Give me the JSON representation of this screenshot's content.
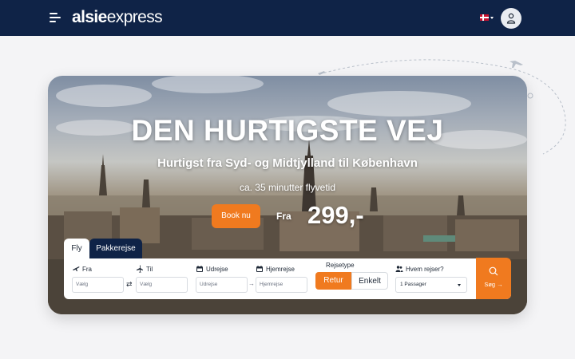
{
  "header": {
    "logo_bold": "alsie",
    "logo_light": "express",
    "language_flag": "dk-flag-icon",
    "user_icon": "user-icon"
  },
  "hero": {
    "title": "DEN HURTIGSTE VEJ",
    "subtitle": "Hurtigst fra Syd- og Midtjylland til København",
    "flight_time": "ca. 35 minutter flyvetid",
    "book_label": "Book nu",
    "price_prefix": "Fra",
    "price": "299,-"
  },
  "tabs": [
    {
      "label": "Fly",
      "active": true
    },
    {
      "label": "Pakkerejse",
      "active": false
    }
  ],
  "search": {
    "from": {
      "label": "Fra",
      "placeholder": "Vælg",
      "icon": "plane-takeoff-icon"
    },
    "to": {
      "label": "Til",
      "placeholder": "Vælg",
      "icon": "plane-landing-icon"
    },
    "departure": {
      "label": "Udrejse",
      "placeholder": "Udrejse",
      "icon": "calendar-icon"
    },
    "return": {
      "label": "Hjemrejse",
      "placeholder": "Hjemrejse",
      "icon": "calendar-icon"
    },
    "trip_type": {
      "label": "Rejsetype",
      "options": [
        "Retur",
        "Enkelt"
      ],
      "selected": "Retur"
    },
    "passengers": {
      "label": "Hvem rejser?",
      "value": "1 Passager",
      "icon": "people-icon"
    },
    "submit_label": "Søg →"
  },
  "colors": {
    "header_bg": "#0f2347",
    "accent": "#f07a1f",
    "page_bg": "#f4f4f6"
  }
}
